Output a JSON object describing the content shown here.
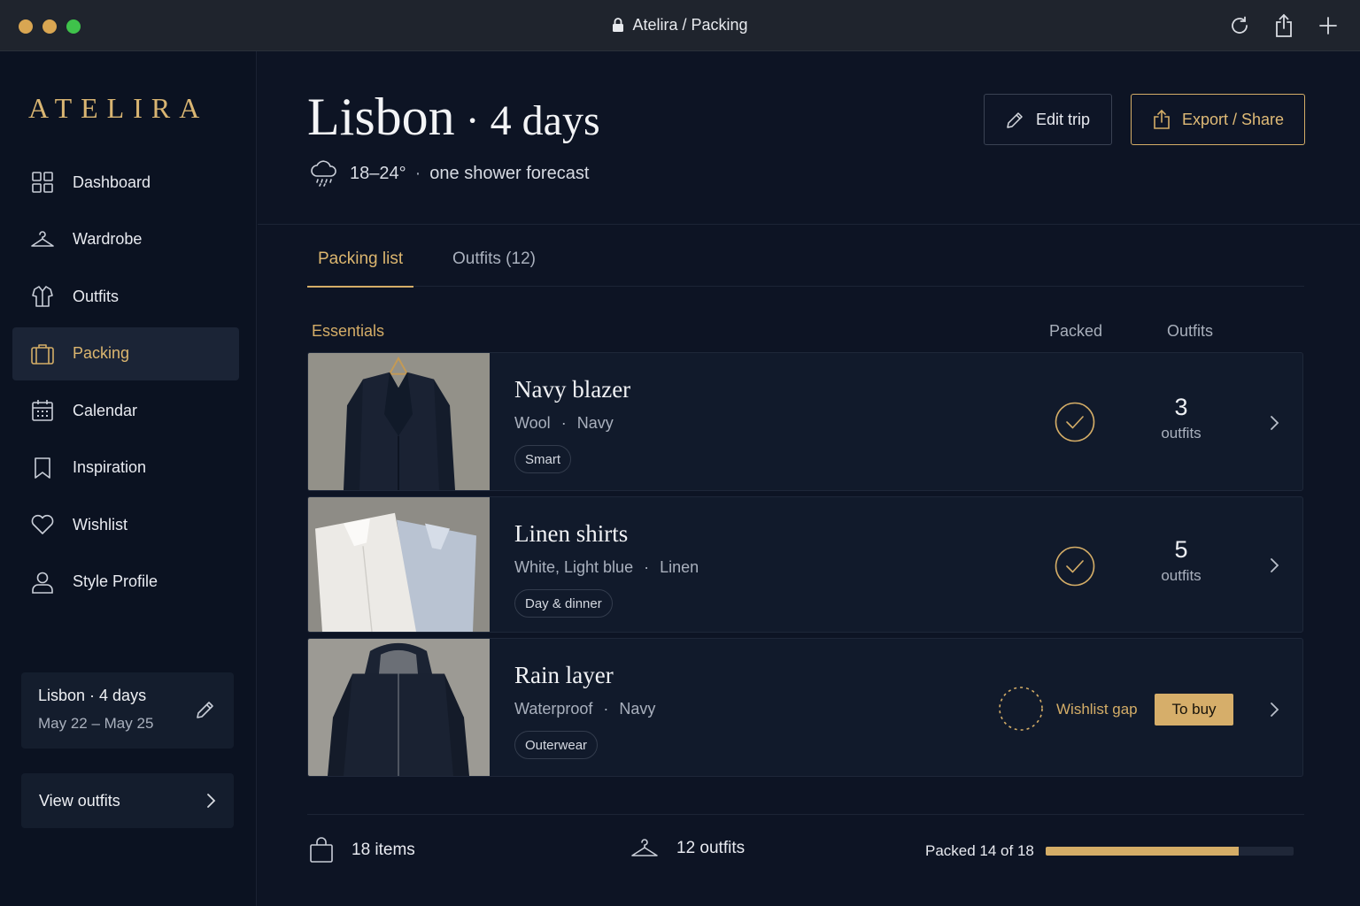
{
  "window": {
    "title": "Atelira / Packing",
    "traffic_colors": [
      "#d9a652",
      "#d9a652",
      "#3fc24b"
    ]
  },
  "sidebar": {
    "logo": "ATELIRA",
    "items": [
      {
        "label": "Dashboard",
        "icon": "grid-icon"
      },
      {
        "label": "Wardrobe",
        "icon": "hanger-icon"
      },
      {
        "label": "Outfits",
        "icon": "shirt-icon"
      },
      {
        "label": "Packing",
        "icon": "suitcase-icon",
        "active": true
      },
      {
        "label": "Calendar",
        "icon": "calendar-icon"
      },
      {
        "label": "Inspiration",
        "icon": "bookmark-icon"
      },
      {
        "label": "Wishlist",
        "icon": "heart-icon"
      },
      {
        "label": "Style Profile",
        "icon": "user-icon"
      }
    ],
    "trip": {
      "title": "Lisbon · 4 days",
      "dates": "May 22 – May 25"
    },
    "view_outfits": "View outfits"
  },
  "header": {
    "city": "Lisbon",
    "duration": " · 4 days",
    "temp": "18–24°",
    "forecast": "one shower forecast",
    "edit_label": "Edit trip",
    "export_label": "Export / Share"
  },
  "tabs": [
    {
      "label": "Packing list",
      "active": true
    },
    {
      "label": "Outfits (12)",
      "active": false
    }
  ],
  "section": {
    "label": "Essentials",
    "col_packed": "Packed",
    "col_outfits": "Outfits"
  },
  "items": [
    {
      "name": "Navy blazer",
      "material": "Wool",
      "color": "Navy",
      "tag": "Smart",
      "packed": true,
      "outfits": "3",
      "outfits_label": "outfits"
    },
    {
      "name": "Linen shirts",
      "material": "White, Light blue",
      "color": "Linen",
      "tag": "Day & dinner",
      "packed": true,
      "outfits": "5",
      "outfits_label": "outfits"
    },
    {
      "name": "Rain layer",
      "material": "Waterproof",
      "color": "Navy",
      "tag": "Outerwear",
      "packed": false,
      "status": "Wishlist gap",
      "action": "To buy"
    }
  ],
  "footer": {
    "items": "18 items",
    "outfits": "12 outfits",
    "progress_label": "Packed 14 of 18",
    "progress_fraction": 0.7778
  },
  "colors": {
    "accent": "#d4ad67",
    "bg": "#0d1424",
    "sidebar_bg": "#0b1221"
  }
}
